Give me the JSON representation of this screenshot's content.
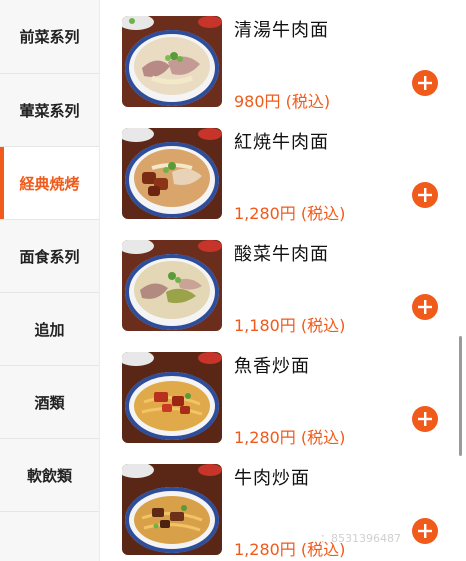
{
  "sidebar": {
    "categories": [
      {
        "label": "前菜系列"
      },
      {
        "label": "葷菜系列"
      },
      {
        "label": "経典焼烤"
      },
      {
        "label": "面食系列"
      },
      {
        "label": "追加"
      },
      {
        "label": "酒類"
      },
      {
        "label": "軟飲類"
      }
    ],
    "active_index": 2
  },
  "items": [
    {
      "name": "清湯牛肉面",
      "price": "980円 (税込)",
      "image_icon": "clear-broth-beef-noodle-photo"
    },
    {
      "name": "紅焼牛肉面",
      "price": "1,280円 (税込)",
      "image_icon": "braised-beef-noodle-photo"
    },
    {
      "name": "酸菜牛肉面",
      "price": "1,180円 (税込)",
      "image_icon": "pickled-cabbage-beef-noodle-photo"
    },
    {
      "name": "魚香炒面",
      "price": "1,280円 (税込)",
      "image_icon": "fish-flavored-fried-noodle-photo"
    },
    {
      "name": "牛肉炒面",
      "price": "1,280円 (税込)",
      "image_icon": "beef-fried-noodle-photo"
    }
  ],
  "add_button_icon": "plus-circle-icon",
  "watermark": "：8531396487",
  "colors": {
    "accent": "#f05a1a",
    "sidebar_bg": "#f7f7f7",
    "active_bg": "#ffffff"
  }
}
